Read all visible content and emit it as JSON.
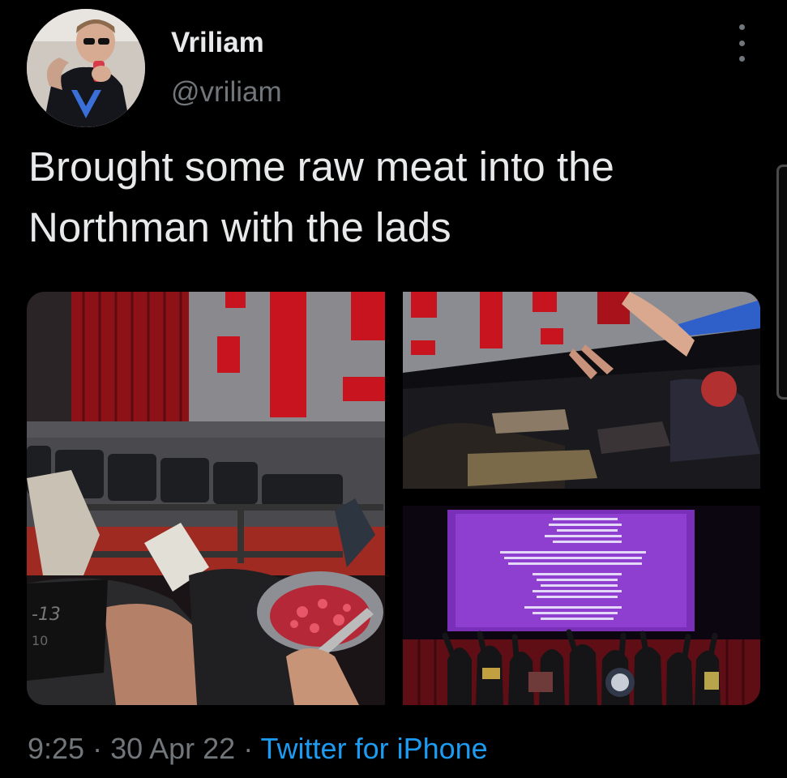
{
  "author": {
    "name": "Vriliam",
    "handle": "@vriliam"
  },
  "tweet": {
    "text": "Brought some raw meat into the Northman with the lads"
  },
  "meta": {
    "time": "9:25",
    "separator": " · ",
    "date": "30 Apr 22",
    "source": "Twitter for iPhone"
  },
  "photo": {
    "tag_line1": "-13",
    "tag_line2": "10"
  },
  "icons": {
    "more": "more-dots-icon"
  },
  "colors": {
    "background": "#000000",
    "text": "#e7e9ea",
    "secondary": "#71767b",
    "link": "#1d9bf0"
  }
}
